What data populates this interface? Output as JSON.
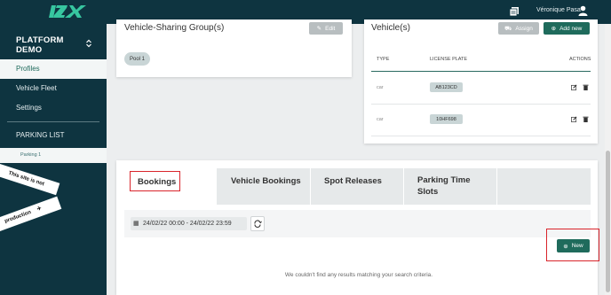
{
  "topbar": {
    "logo_icon": "izix-logo",
    "user_name": "Véronique Pasa",
    "notif_icon": "documents-icon",
    "user_icon": "user-icon"
  },
  "sidebar": {
    "brand_line1": "PLATFORM",
    "brand_line2": "DEMO",
    "items": [
      {
        "label": "Profiles",
        "active": true
      },
      {
        "label": "Vehicle Fleet",
        "active": false
      },
      {
        "label": "Settings",
        "active": false
      }
    ],
    "parking_header": "PARKING LIST",
    "parking_items": [
      {
        "label": "Parking 1"
      }
    ],
    "ribbon_line1": "This site is not",
    "ribbon_line2": "production"
  },
  "sharing_group": {
    "title": "Vehicle-Sharing Group(s)",
    "edit_label": "Edit",
    "pools": [
      "Pool 1"
    ]
  },
  "vehicles": {
    "title": "Vehicle(s)",
    "assign_label": "Assign",
    "add_label": "Add new",
    "columns": [
      "TYPE",
      "LICENSE PLATE",
      "ACTIONS"
    ],
    "rows": [
      {
        "type": "car",
        "plate": "AB123CD"
      },
      {
        "type": "car",
        "plate": "10HF698"
      }
    ]
  },
  "tabs": [
    {
      "label": "Bookings",
      "active": true
    },
    {
      "label": "Vehicle Bookings",
      "active": false
    },
    {
      "label": "Spot Releases",
      "active": false
    },
    {
      "label_line1": "Parking Time",
      "label_line2": "Slots",
      "active": false
    }
  ],
  "filter": {
    "date_range": "24/02/22 00:00 - 24/02/22 23:59"
  },
  "new_button_label": "New",
  "empty_message": "We couldn't find any results matching your search criteria.",
  "colors": {
    "navy": "#0e3440",
    "accent": "#1f6b5c",
    "highlight": "#d9242b"
  }
}
